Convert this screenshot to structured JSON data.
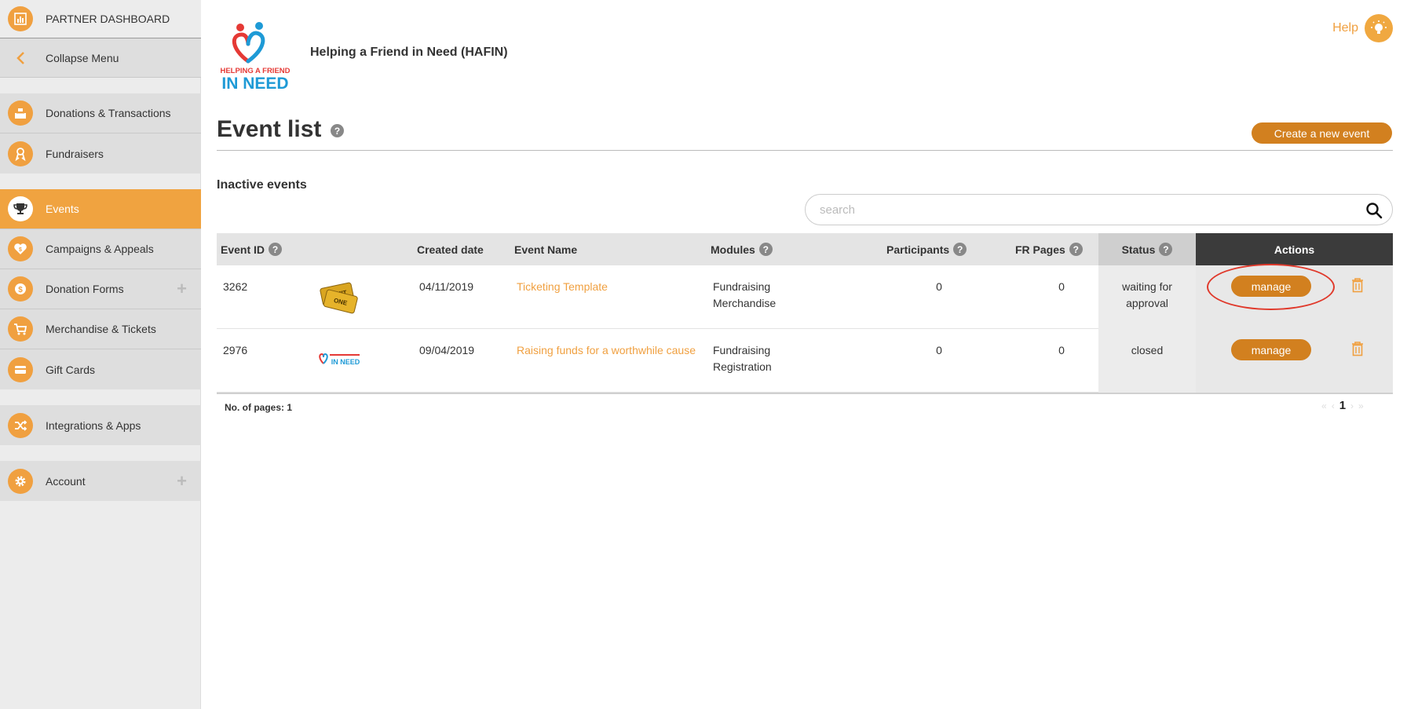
{
  "sidebar": {
    "dashboard_label": "PARTNER DASHBOARD",
    "collapse_label": "Collapse Menu",
    "items": [
      {
        "label": "Donations & Transactions"
      },
      {
        "label": "Fundraisers"
      },
      {
        "label": "Events"
      },
      {
        "label": "Campaigns & Appeals"
      },
      {
        "label": "Donation Forms"
      },
      {
        "label": "Merchandise & Tickets"
      },
      {
        "label": "Gift Cards"
      },
      {
        "label": "Integrations & Apps"
      },
      {
        "label": "Account"
      }
    ],
    "accent_color": "#f0a340"
  },
  "header": {
    "logo_text_top": "HELPING A FRIEND",
    "logo_text_bottom": "IN NEED",
    "org_name": "Helping a Friend in Need (HAFIN)",
    "help_label": "Help"
  },
  "page": {
    "title": "Event list",
    "create_button": "Create a new event",
    "section_title": "Inactive events",
    "search_placeholder": "search"
  },
  "table": {
    "columns": {
      "event_id": "Event ID",
      "created_date": "Created date",
      "event_name": "Event Name",
      "modules": "Modules",
      "participants": "Participants",
      "fr_pages": "FR Pages",
      "status": "Status",
      "actions": "Actions"
    },
    "rows": [
      {
        "event_id": "3262",
        "created_date": "04/11/2019",
        "event_name": "Ticketing Template",
        "modules_1": "Fundraising",
        "modules_2": "Merchandise",
        "participants": "0",
        "fr_pages": "0",
        "status_1": "waiting for",
        "status_2": "approval",
        "action": "manage"
      },
      {
        "event_id": "2976",
        "created_date": "09/04/2019",
        "event_name": "Raising funds for a worthwhile cause",
        "modules_1": "Fundraising",
        "modules_2": "Registration",
        "participants": "0",
        "fr_pages": "0",
        "status_1": "closed",
        "status_2": "",
        "action": "manage"
      }
    ],
    "thumb_ticket_text_1": "ADMIT",
    "thumb_ticket_text_2": "ONE",
    "thumb_logo_text": "IN NEED"
  },
  "pagination": {
    "pages_label": "No. of pages: 1",
    "current_page": "1",
    "first": "«",
    "prev": "‹",
    "next": "›",
    "last": "»"
  },
  "colors": {
    "orange": "#f0a040",
    "button": "#d2801f",
    "highlight": "#e0392b"
  }
}
